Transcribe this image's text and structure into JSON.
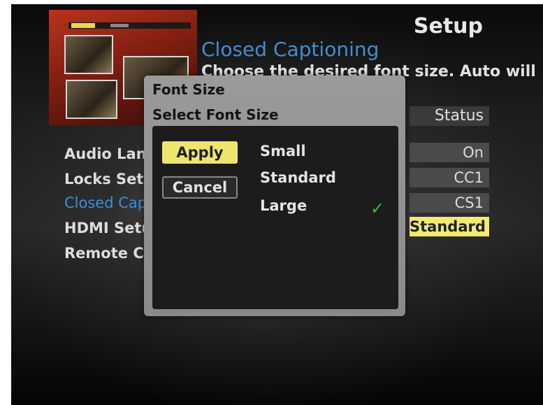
{
  "header": {
    "title": "Setup"
  },
  "section": {
    "title": "Closed Captioning",
    "description": "Choose the desired font size. Auto will"
  },
  "status_header": "Status",
  "menu": {
    "items": [
      {
        "label": "Audio Lang"
      },
      {
        "label": "Locks Setu"
      },
      {
        "label": "Closed Cap"
      },
      {
        "label": "HDMI Setu"
      },
      {
        "label": "Remote Co"
      }
    ]
  },
  "status_values": [
    "On",
    "CC1",
    "CS1",
    "Standard"
  ],
  "dialog": {
    "title": "Font Size",
    "subtitle": "Select Font Size",
    "apply_label": "Apply",
    "cancel_label": "Cancel",
    "options": [
      "Small",
      "Standard",
      "Large"
    ],
    "selected_option": "Large",
    "check_icon": "check-icon"
  },
  "colors": {
    "highlight_blue": "#3e8fd6",
    "selection_yellow": "#efe46e",
    "check_green": "#3cb84a"
  }
}
